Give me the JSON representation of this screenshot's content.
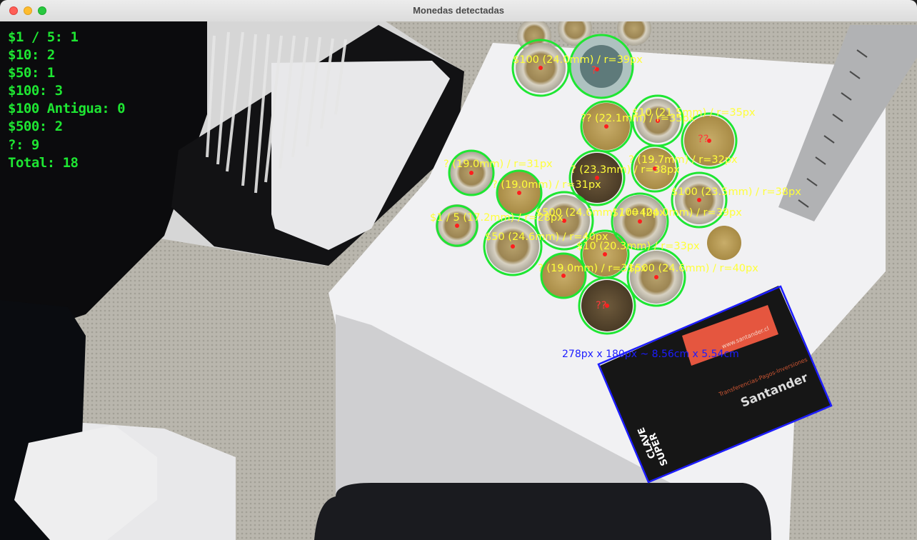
{
  "window": {
    "title": "Monedas detectadas"
  },
  "counts": {
    "c1_5": "$1 / 5: 1",
    "c10": "$10: 2",
    "c50": "$50: 1",
    "c100": "$100: 3",
    "c100_old": "$100 Antigua: 0",
    "c500": "$500: 2",
    "unknown": "?: 9",
    "total": "Total: 18"
  },
  "detections": {
    "d1": "$100 (24.0mm) / r=39px",
    "d2": "?",
    "d3": "?? (22.1mm) / r=35px",
    "d4": "$10 (21.5mm) / r=35px",
    "d5": "??",
    "d6": "? (19.7mm) / r=32px",
    "d7": "? (19.0mm) / r=31px",
    "d8": "? (23.3mm) / r=38px",
    "d9": "? (19.0mm) / r=31px",
    "d10": "$100 (23.5mm) / r=38px",
    "d11": "$1 / 5 (17.2mm) / r=28px",
    "d12": "$500 (24.6mm) / r=40px",
    "d13": "$100 (24.0mm) / r=39px",
    "d14": "$50 (24.6mm) / r=40px",
    "d15": "$10 (20.3mm) / r=33px",
    "d16": "? (19.0mm) / r=31px",
    "d17": "$500 (24.6mm) / r=40px",
    "d18": "??"
  },
  "card_measure": "278px x 180px ~ 8.56cm x 5.54cm",
  "card_print": {
    "bank": "Santander",
    "product_top": "SUPER",
    "product_bottom": "CLAVE",
    "subtitle": "Transferencias-Pagos-Inversiones",
    "stripe_text": "www.santander.cl"
  },
  "colors": {
    "counts_text": "#1ee632",
    "coin_circle": "#1ee632",
    "center_dot": "#ff1e1e",
    "detection_label": "#ffff3a",
    "card_box": "#1d1dff"
  }
}
